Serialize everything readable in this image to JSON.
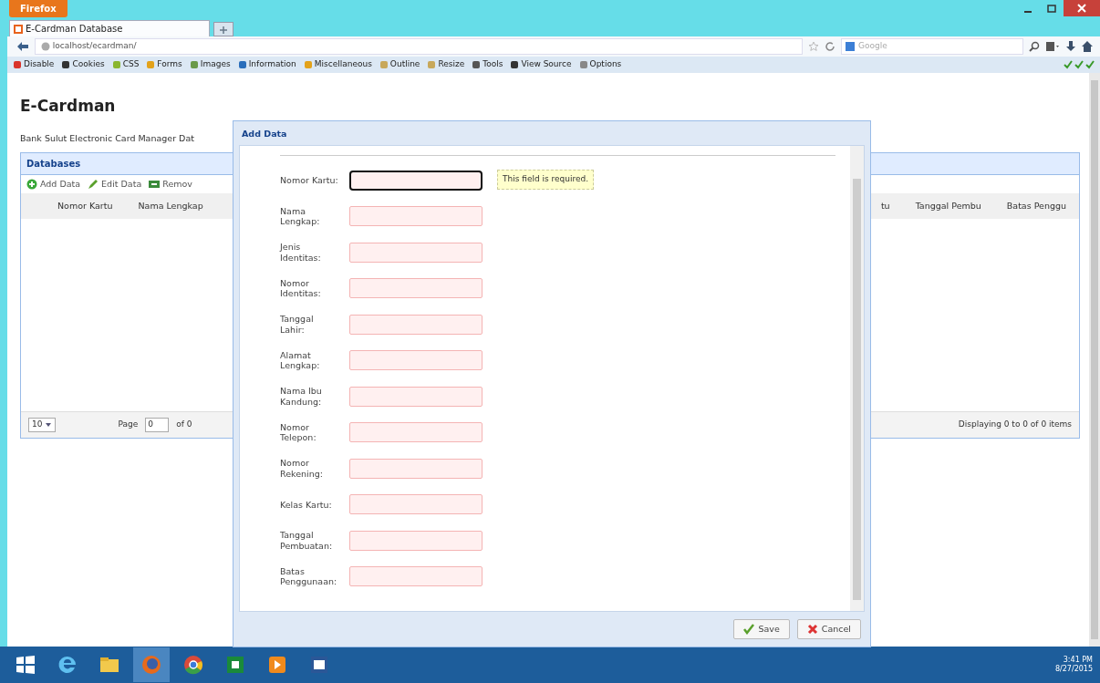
{
  "browser": {
    "menu_button": "Firefox",
    "tabs": [
      {
        "label": "E-Cardman Database",
        "selected": true
      }
    ],
    "address": "localhost/ecardman/",
    "search_placeholder": "Google",
    "devtools": [
      {
        "label": "Disable",
        "color": "#d9342b"
      },
      {
        "label": "Cookies",
        "color": "#333333"
      },
      {
        "label": "CSS",
        "color": "#8ab630"
      },
      {
        "label": "Forms",
        "color": "#e3a21a"
      },
      {
        "label": "Images",
        "color": "#6a9a4a"
      },
      {
        "label": "Information",
        "color": "#2a6ebb"
      },
      {
        "label": "Miscellaneous",
        "color": "#e3a21a"
      },
      {
        "label": "Outline",
        "color": "#c8a85a"
      },
      {
        "label": "Resize",
        "color": "#c8a85a"
      },
      {
        "label": "Tools",
        "color": "#555555"
      },
      {
        "label": "View Source",
        "color": "#333333"
      },
      {
        "label": "Options",
        "color": "#888888"
      }
    ]
  },
  "page": {
    "title": "E-Cardman",
    "subtitle": "Bank Sulut Electronic Card Manager Dat",
    "panel": {
      "title": "Databases",
      "toolbar": [
        {
          "label": "Add Data",
          "kind": "add"
        },
        {
          "label": "Edit Data",
          "kind": "edit"
        },
        {
          "label": "Remov",
          "kind": "remove"
        }
      ],
      "columns_left": [
        "Nomor Kartu",
        "Nama Lengkap"
      ],
      "columns_right": [
        "tu",
        "Tanggal Pembu",
        "Batas Penggu"
      ],
      "pager": {
        "page_size": "10",
        "page_label": "Page",
        "page": "0",
        "of": "of 0",
        "summary": "Displaying 0 to 0 of 0 items"
      }
    }
  },
  "dialog": {
    "title": "Add Data",
    "fields": [
      {
        "label": "Nomor Kartu:",
        "invalid": true,
        "focused": true
      },
      {
        "label": "Nama Lengkap:",
        "invalid": true,
        "focused": false
      },
      {
        "label": "Jenis Identitas:",
        "invalid": true,
        "focused": false
      },
      {
        "label": "Nomor Identitas:",
        "invalid": true,
        "focused": false
      },
      {
        "label": "Tanggal Lahir:",
        "invalid": true,
        "focused": false
      },
      {
        "label": "Alamat Lengkap:",
        "invalid": true,
        "focused": false
      },
      {
        "label": "Nama Ibu Kandung:",
        "invalid": true,
        "focused": false
      },
      {
        "label": "Nomor Telepon:",
        "invalid": true,
        "focused": false
      },
      {
        "label": "Nomor Rekening:",
        "invalid": true,
        "focused": false
      },
      {
        "label": "Kelas Kartu:",
        "invalid": true,
        "focused": false
      },
      {
        "label": "Tanggal Pembuatan:",
        "invalid": true,
        "focused": false
      },
      {
        "label": "Batas Penggunaan:",
        "invalid": true,
        "focused": false
      }
    ],
    "tooltip": "This field is required.",
    "buttons": [
      {
        "label": "Save",
        "kind": "save"
      },
      {
        "label": "Cancel",
        "kind": "cancel"
      }
    ]
  },
  "taskbar": {
    "apps": [
      {
        "kind": "ie",
        "active": false
      },
      {
        "kind": "explorer",
        "active": false
      },
      {
        "kind": "firefox",
        "active": true
      },
      {
        "kind": "chrome",
        "active": false
      },
      {
        "kind": "store",
        "active": false
      },
      {
        "kind": "media",
        "active": false
      },
      {
        "kind": "word",
        "active": false
      }
    ],
    "time": "3:41 PM",
    "date": "8/27/2015"
  }
}
